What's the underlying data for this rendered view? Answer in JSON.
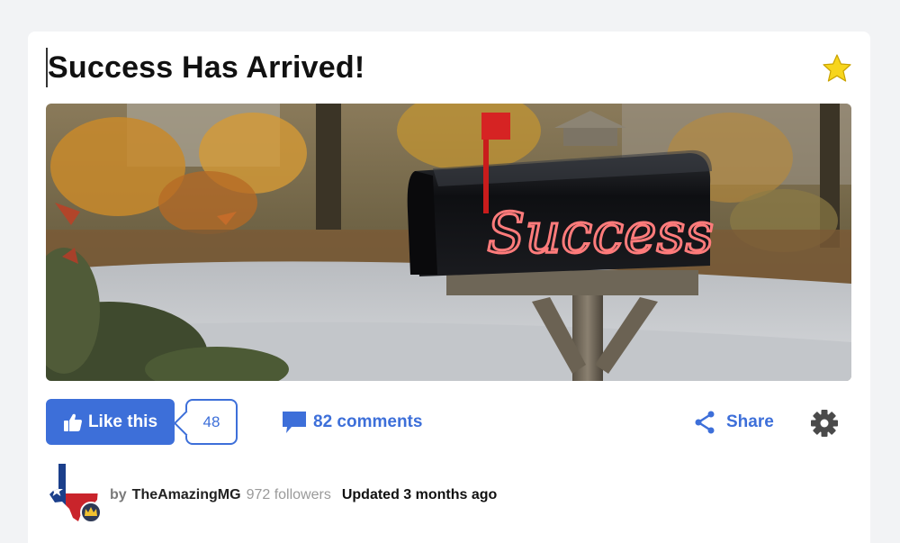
{
  "article": {
    "title": "Success Has Arrived!",
    "hero_image": {
      "description": "black mailbox with red flag on wooden post, autumn street background",
      "mailbox_text": "Success"
    }
  },
  "actions": {
    "like_label": "Like this",
    "like_count": "48",
    "comments_label": "82 comments",
    "share_label": "Share"
  },
  "author": {
    "by_label": "by",
    "name": "TheAmazingMG",
    "followers": "972 followers",
    "updated": "Updated 3 months ago"
  },
  "icons": {
    "favorite": "star-icon",
    "like": "thumbs-up-icon",
    "comments": "speech-bubble-icon",
    "share": "share-icon",
    "settings": "gear-icon",
    "avatar_badge": "crown-icon"
  },
  "colors": {
    "accent": "#3d6fd9",
    "star": "#f7d51d",
    "mailbox_text": "#e85a5a"
  }
}
